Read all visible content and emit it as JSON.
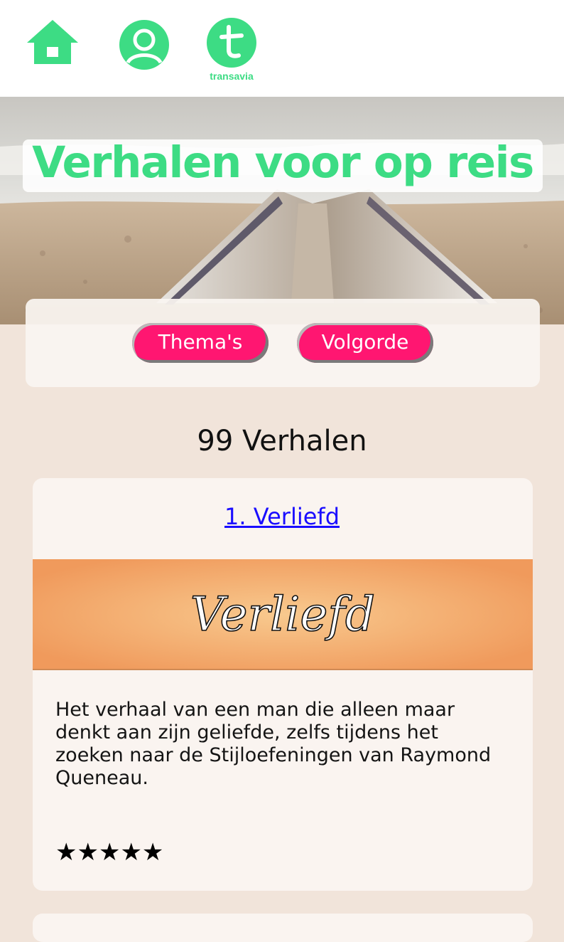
{
  "header": {
    "nav": [
      {
        "icon": "home-icon"
      },
      {
        "icon": "profile-icon"
      },
      {
        "icon": "transavia-logo",
        "label": "transavia"
      }
    ],
    "brand_color": "#3ddc84"
  },
  "hero": {
    "title": "Verhalen voor op reis"
  },
  "filters": {
    "themas_label": "Thema's",
    "volgorde_label": "Volgorde",
    "button_color": "#ff1671"
  },
  "list": {
    "count_label": "99 Verhalen",
    "stories": [
      {
        "title": "1. Verliefd",
        "banner_text": "Verliefd",
        "description": "Het verhaal van een man die alleen maar denkt aan zijn geliefde, zelfs tijdens het zoeken naar de Stijloefeningen van Raymond Queneau.",
        "stars": "★★★★★",
        "rating": 5
      }
    ]
  }
}
